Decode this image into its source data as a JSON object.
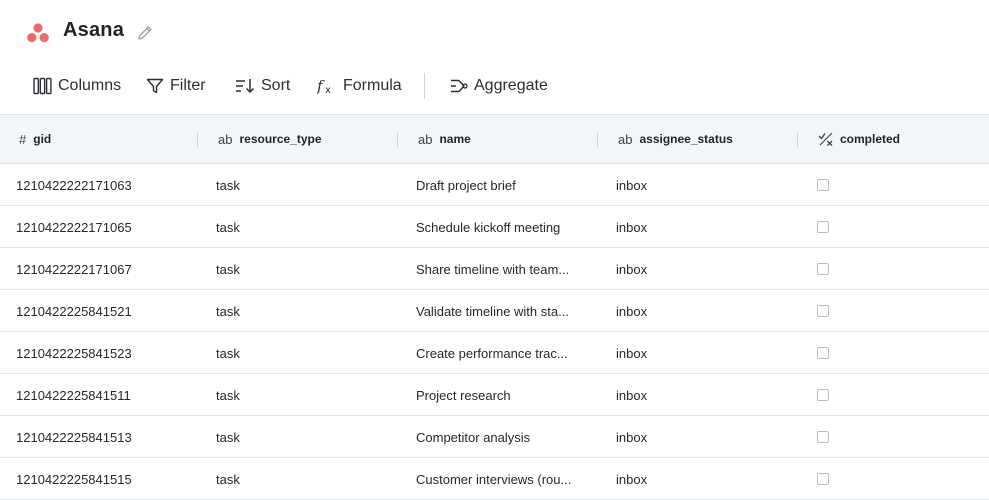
{
  "app": {
    "title": "Asana",
    "logo_icon": "asana-logo-icon",
    "edit_icon": "pencil-icon",
    "brand_color": "#f06a6a"
  },
  "toolbar": {
    "columns_label": "Columns",
    "filter_label": "Filter",
    "sort_label": "Sort",
    "formula_label": "Formula",
    "aggregate_label": "Aggregate"
  },
  "columns": [
    {
      "type_icon": "#",
      "name": "gid"
    },
    {
      "type_icon": "ab",
      "name": "resource_type"
    },
    {
      "type_icon": "ab",
      "name": "name"
    },
    {
      "type_icon": "ab",
      "name": "assignee_status"
    },
    {
      "type_icon": "boolean-icon",
      "name": "completed"
    }
  ],
  "rows": [
    {
      "gid": "1210422222171063",
      "resource_type": "task",
      "name": "Draft project brief",
      "assignee_status": "inbox",
      "completed": false
    },
    {
      "gid": "1210422222171065",
      "resource_type": "task",
      "name": "Schedule kickoff meeting",
      "assignee_status": "inbox",
      "completed": false
    },
    {
      "gid": "1210422222171067",
      "resource_type": "task",
      "name": "Share timeline with team...",
      "assignee_status": "inbox",
      "completed": false
    },
    {
      "gid": "1210422225841521",
      "resource_type": "task",
      "name": "Validate timeline with sta...",
      "assignee_status": "inbox",
      "completed": false
    },
    {
      "gid": "1210422225841523",
      "resource_type": "task",
      "name": "Create performance trac...",
      "assignee_status": "inbox",
      "completed": false
    },
    {
      "gid": "1210422225841511",
      "resource_type": "task",
      "name": "Project research",
      "assignee_status": "inbox",
      "completed": false
    },
    {
      "gid": "1210422225841513",
      "resource_type": "task",
      "name": "Competitor analysis",
      "assignee_status": "inbox",
      "completed": false
    },
    {
      "gid": "1210422225841515",
      "resource_type": "task",
      "name": "Customer interviews (rou...",
      "assignee_status": "inbox",
      "completed": false
    }
  ]
}
